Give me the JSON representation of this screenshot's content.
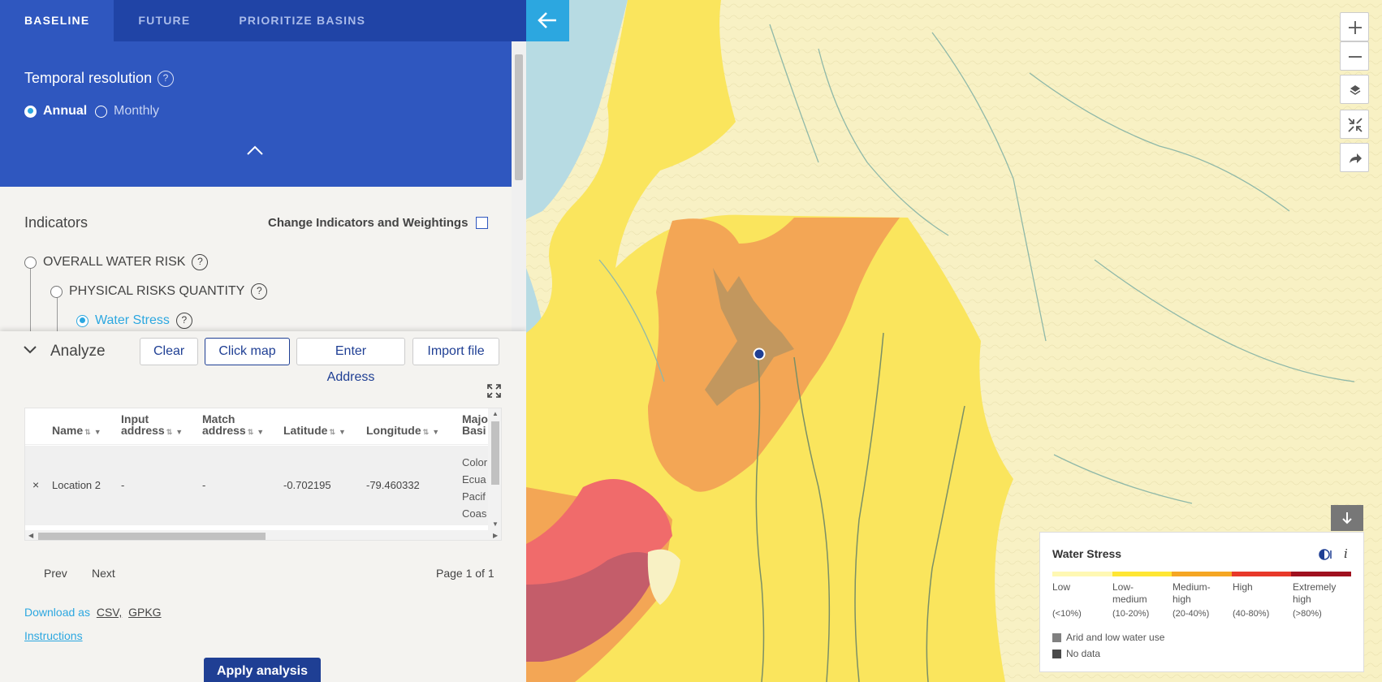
{
  "tabs": [
    {
      "label": "BASELINE",
      "active": true
    },
    {
      "label": "FUTURE",
      "active": false
    },
    {
      "label": "PRIORITIZE BASINS",
      "active": false
    }
  ],
  "temporal": {
    "label": "Temporal resolution",
    "help": "?",
    "options": [
      {
        "label": "Annual",
        "selected": true
      },
      {
        "label": "Monthly",
        "selected": false
      }
    ]
  },
  "indicators": {
    "title": "Indicators",
    "change_label": "Change Indicators and Weightings",
    "items": [
      {
        "label": "OVERALL WATER RISK",
        "selected": false
      },
      {
        "label": "PHYSICAL RISKS QUANTITY",
        "selected": false
      },
      {
        "label": "Water Stress",
        "selected": true
      }
    ],
    "help": "?"
  },
  "analyze": {
    "title": "Analyze",
    "buttons": {
      "clear": "Clear",
      "click_map": "Click map",
      "enter_address": "Enter Address",
      "import_file": "Import file"
    },
    "selected_button": "Click map",
    "table": {
      "columns": [
        {
          "line1": "Name",
          "line2": ""
        },
        {
          "line1": "Input",
          "line2": "address"
        },
        {
          "line1": "Match",
          "line2": "address"
        },
        {
          "line1": "Latitude",
          "line2": ""
        },
        {
          "line1": "Longitude",
          "line2": ""
        },
        {
          "line1": "Majo",
          "line2": "Basi"
        }
      ],
      "rows": [
        {
          "remove": "×",
          "name": "Location 2",
          "input_address": "-",
          "match_address": "-",
          "latitude": "-0.702195",
          "longitude": "-79.460332",
          "basin_lines": [
            "Color",
            "Ecua",
            "Pacif",
            "Coas"
          ]
        }
      ]
    },
    "pagination": {
      "prev": "Prev",
      "next": "Next",
      "page_info": "Page 1 of 1"
    },
    "download": {
      "label": "Download as",
      "csv": "CSV,",
      "gpkg": "GPKG"
    },
    "instructions": "Instructions",
    "apply": "Apply analysis"
  },
  "legend": {
    "title": "Water Stress",
    "info": "i",
    "categories": [
      {
        "label_lines": [
          "Low"
        ],
        "range": "(<10%)",
        "color": "#fff8b3"
      },
      {
        "label_lines": [
          "Low-",
          "medium"
        ],
        "range": "(10-20%)",
        "color": "#ffe633"
      },
      {
        "label_lines": [
          "Medium-",
          "high"
        ],
        "range": "(20-40%)",
        "color": "#f5a623"
      },
      {
        "label_lines": [
          "High"
        ],
        "range": "(40-80%)",
        "color": "#e8392a"
      },
      {
        "label_lines": [
          "Extremely",
          "high"
        ],
        "range": "(>80%)",
        "color": "#a0111f"
      }
    ],
    "extras": [
      {
        "label": "Arid and low water use",
        "color": "#808080"
      },
      {
        "label": "No data",
        "color": "#4a4a4a"
      }
    ]
  },
  "colors": {
    "tab_bar": "#2044a6",
    "panel_blue": "#2f57bf",
    "accent": "#2ca7e0",
    "button_dark": "#1f3f94",
    "water": "#b7dbe3"
  },
  "map_controls": [
    "zoom-in-icon",
    "zoom-out-icon",
    "layers-icon",
    "shrink-icon",
    "share-icon"
  ]
}
